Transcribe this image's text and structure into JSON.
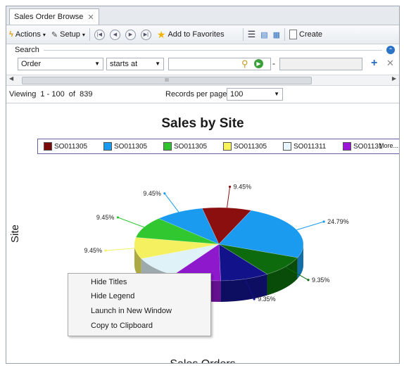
{
  "tab": {
    "title": "Sales Order Browse",
    "close": "✕"
  },
  "toolbar": {
    "actions": "Actions",
    "setup": "Setup",
    "add_favorites": "Add to Favorites",
    "create": "Create"
  },
  "search": {
    "label": "Search",
    "field": "Order",
    "operator": "starts at",
    "value": "",
    "separator": "-",
    "value2": ""
  },
  "scroll_marker": "III",
  "status": {
    "viewing": "Viewing  1 - 100  of  839",
    "records_label": "Records per page:",
    "records_value": "100"
  },
  "chart_data": {
    "type": "pie",
    "title": "Sales by Site",
    "xlabel": "Sales Orders",
    "ylabel": "Site",
    "legend_more": "More...",
    "legend": [
      {
        "label": "SO011305",
        "color": "#7b0a0a"
      },
      {
        "label": "SO011305",
        "color": "#1a9bf0"
      },
      {
        "label": "SO011305",
        "color": "#2ec42e"
      },
      {
        "label": "SO011305",
        "color": "#f7f35a"
      },
      {
        "label": "SO011311",
        "color": "#e6f6fa"
      },
      {
        "label": "SO01131",
        "color": "#9a16d6"
      }
    ],
    "slices": [
      {
        "value": 9.45,
        "label": "9.45%",
        "color": "#8b0f0f"
      },
      {
        "value": 24.79,
        "label": "24.79%",
        "color": "#1a9bf0"
      },
      {
        "value": 9.35,
        "label": "9.35%",
        "color": "#0d6b0d"
      },
      {
        "value": 9.35,
        "label": "9.35%",
        "color": "#12128a"
      },
      {
        "value": 9.45,
        "label": "",
        "color": "#8d18cc"
      },
      {
        "value": 9.45,
        "label": "",
        "color": "#dff2f7"
      },
      {
        "value": 9.45,
        "label": "9.45%",
        "color": "#f5f060"
      },
      {
        "value": 9.45,
        "label": "9.45%",
        "color": "#30c730"
      },
      {
        "value": 9.45,
        "label": "9.45%",
        "color": "#1a9bf0"
      }
    ]
  },
  "context_menu": [
    "Hide Titles",
    "Hide Legend",
    "Launch in New Window",
    "Copy to Clipboard"
  ]
}
